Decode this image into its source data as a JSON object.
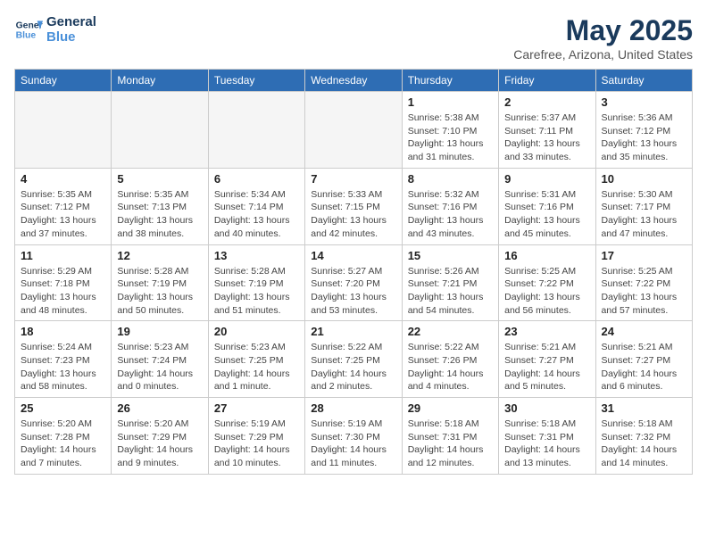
{
  "header": {
    "logo_line1": "General",
    "logo_line2": "Blue",
    "month": "May 2025",
    "location": "Carefree, Arizona, United States"
  },
  "weekdays": [
    "Sunday",
    "Monday",
    "Tuesday",
    "Wednesday",
    "Thursday",
    "Friday",
    "Saturday"
  ],
  "weeks": [
    [
      {
        "date": "",
        "info": ""
      },
      {
        "date": "",
        "info": ""
      },
      {
        "date": "",
        "info": ""
      },
      {
        "date": "",
        "info": ""
      },
      {
        "date": "1",
        "info": "Sunrise: 5:38 AM\nSunset: 7:10 PM\nDaylight: 13 hours\nand 31 minutes."
      },
      {
        "date": "2",
        "info": "Sunrise: 5:37 AM\nSunset: 7:11 PM\nDaylight: 13 hours\nand 33 minutes."
      },
      {
        "date": "3",
        "info": "Sunrise: 5:36 AM\nSunset: 7:12 PM\nDaylight: 13 hours\nand 35 minutes."
      }
    ],
    [
      {
        "date": "4",
        "info": "Sunrise: 5:35 AM\nSunset: 7:12 PM\nDaylight: 13 hours\nand 37 minutes."
      },
      {
        "date": "5",
        "info": "Sunrise: 5:35 AM\nSunset: 7:13 PM\nDaylight: 13 hours\nand 38 minutes."
      },
      {
        "date": "6",
        "info": "Sunrise: 5:34 AM\nSunset: 7:14 PM\nDaylight: 13 hours\nand 40 minutes."
      },
      {
        "date": "7",
        "info": "Sunrise: 5:33 AM\nSunset: 7:15 PM\nDaylight: 13 hours\nand 42 minutes."
      },
      {
        "date": "8",
        "info": "Sunrise: 5:32 AM\nSunset: 7:16 PM\nDaylight: 13 hours\nand 43 minutes."
      },
      {
        "date": "9",
        "info": "Sunrise: 5:31 AM\nSunset: 7:16 PM\nDaylight: 13 hours\nand 45 minutes."
      },
      {
        "date": "10",
        "info": "Sunrise: 5:30 AM\nSunset: 7:17 PM\nDaylight: 13 hours\nand 47 minutes."
      }
    ],
    [
      {
        "date": "11",
        "info": "Sunrise: 5:29 AM\nSunset: 7:18 PM\nDaylight: 13 hours\nand 48 minutes."
      },
      {
        "date": "12",
        "info": "Sunrise: 5:28 AM\nSunset: 7:19 PM\nDaylight: 13 hours\nand 50 minutes."
      },
      {
        "date": "13",
        "info": "Sunrise: 5:28 AM\nSunset: 7:19 PM\nDaylight: 13 hours\nand 51 minutes."
      },
      {
        "date": "14",
        "info": "Sunrise: 5:27 AM\nSunset: 7:20 PM\nDaylight: 13 hours\nand 53 minutes."
      },
      {
        "date": "15",
        "info": "Sunrise: 5:26 AM\nSunset: 7:21 PM\nDaylight: 13 hours\nand 54 minutes."
      },
      {
        "date": "16",
        "info": "Sunrise: 5:25 AM\nSunset: 7:22 PM\nDaylight: 13 hours\nand 56 minutes."
      },
      {
        "date": "17",
        "info": "Sunrise: 5:25 AM\nSunset: 7:22 PM\nDaylight: 13 hours\nand 57 minutes."
      }
    ],
    [
      {
        "date": "18",
        "info": "Sunrise: 5:24 AM\nSunset: 7:23 PM\nDaylight: 13 hours\nand 58 minutes."
      },
      {
        "date": "19",
        "info": "Sunrise: 5:23 AM\nSunset: 7:24 PM\nDaylight: 14 hours\nand 0 minutes."
      },
      {
        "date": "20",
        "info": "Sunrise: 5:23 AM\nSunset: 7:25 PM\nDaylight: 14 hours\nand 1 minute."
      },
      {
        "date": "21",
        "info": "Sunrise: 5:22 AM\nSunset: 7:25 PM\nDaylight: 14 hours\nand 2 minutes."
      },
      {
        "date": "22",
        "info": "Sunrise: 5:22 AM\nSunset: 7:26 PM\nDaylight: 14 hours\nand 4 minutes."
      },
      {
        "date": "23",
        "info": "Sunrise: 5:21 AM\nSunset: 7:27 PM\nDaylight: 14 hours\nand 5 minutes."
      },
      {
        "date": "24",
        "info": "Sunrise: 5:21 AM\nSunset: 7:27 PM\nDaylight: 14 hours\nand 6 minutes."
      }
    ],
    [
      {
        "date": "25",
        "info": "Sunrise: 5:20 AM\nSunset: 7:28 PM\nDaylight: 14 hours\nand 7 minutes."
      },
      {
        "date": "26",
        "info": "Sunrise: 5:20 AM\nSunset: 7:29 PM\nDaylight: 14 hours\nand 9 minutes."
      },
      {
        "date": "27",
        "info": "Sunrise: 5:19 AM\nSunset: 7:29 PM\nDaylight: 14 hours\nand 10 minutes."
      },
      {
        "date": "28",
        "info": "Sunrise: 5:19 AM\nSunset: 7:30 PM\nDaylight: 14 hours\nand 11 minutes."
      },
      {
        "date": "29",
        "info": "Sunrise: 5:18 AM\nSunset: 7:31 PM\nDaylight: 14 hours\nand 12 minutes."
      },
      {
        "date": "30",
        "info": "Sunrise: 5:18 AM\nSunset: 7:31 PM\nDaylight: 14 hours\nand 13 minutes."
      },
      {
        "date": "31",
        "info": "Sunrise: 5:18 AM\nSunset: 7:32 PM\nDaylight: 14 hours\nand 14 minutes."
      }
    ]
  ]
}
